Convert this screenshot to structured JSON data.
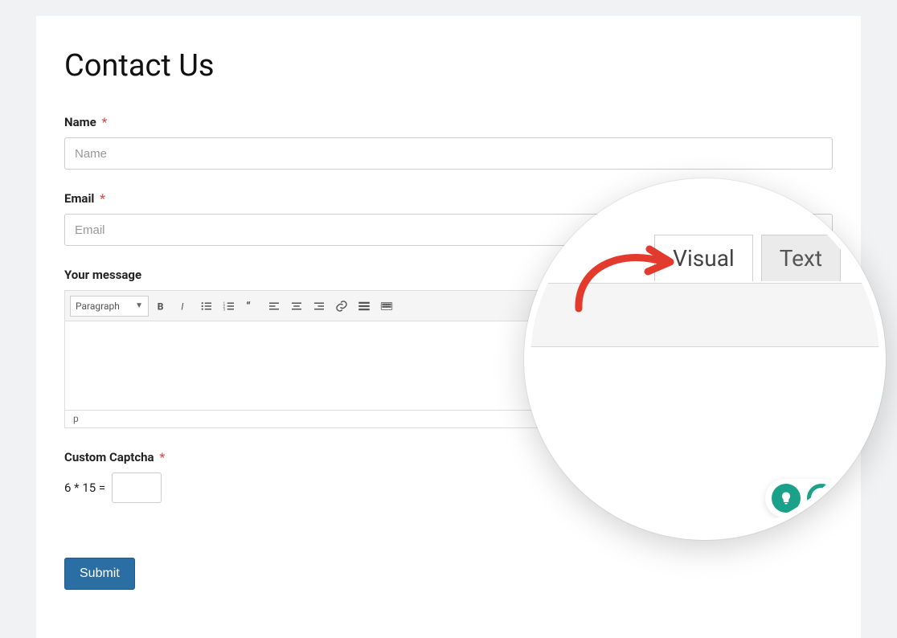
{
  "page": {
    "title": "Contact Us"
  },
  "fields": {
    "name": {
      "label": "Name",
      "placeholder": "Name",
      "required_mark": "*"
    },
    "email": {
      "label": "Email",
      "placeholder": "Email",
      "required_mark": "*"
    },
    "message": {
      "label": "Your message"
    },
    "captcha": {
      "label": "Custom Captcha",
      "required_mark": "*",
      "question": "6 * 15 ="
    }
  },
  "editor": {
    "format_label": "Paragraph",
    "status_path": "p"
  },
  "submit": {
    "label": "Submit"
  },
  "magnifier": {
    "tab_visual": "Visual",
    "tab_text": "Text"
  }
}
